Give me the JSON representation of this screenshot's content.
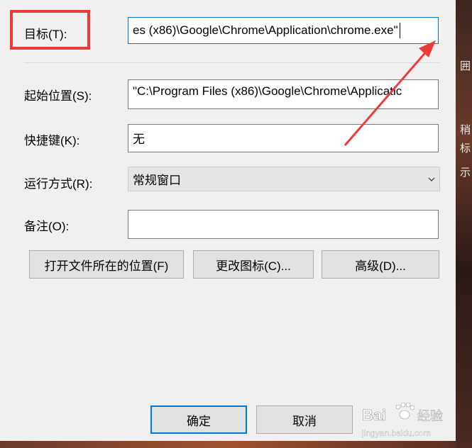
{
  "properties": {
    "target": {
      "label": "目标(T):",
      "value": "es (x86)\\Google\\Chrome\\Application\\chrome.exe\""
    },
    "start_in": {
      "label": "起始位置(S):",
      "value": "\"C:\\Program Files (x86)\\Google\\Chrome\\Applicatic"
    },
    "shortcut_key": {
      "label": "快捷键(K):",
      "value": "无"
    },
    "run": {
      "label": "运行方式(R):",
      "value": "常规窗口"
    },
    "comment": {
      "label": "备注(O):",
      "value": ""
    }
  },
  "buttons": {
    "open_location": "打开文件所在的位置(F)",
    "change_icon": "更改图标(C)...",
    "advanced": "高级(D)...",
    "ok": "确定",
    "cancel": "取消"
  },
  "watermark": {
    "brand": "Bai",
    "sub": "经验",
    "url": "jingyan.baidu.com"
  },
  "desktop_fragments": [
    "囲",
    "稍",
    "标",
    "示"
  ],
  "colors": {
    "highlight": "#ec3b3b",
    "focus": "#0078d7",
    "field_border": "#7a7a7a"
  }
}
